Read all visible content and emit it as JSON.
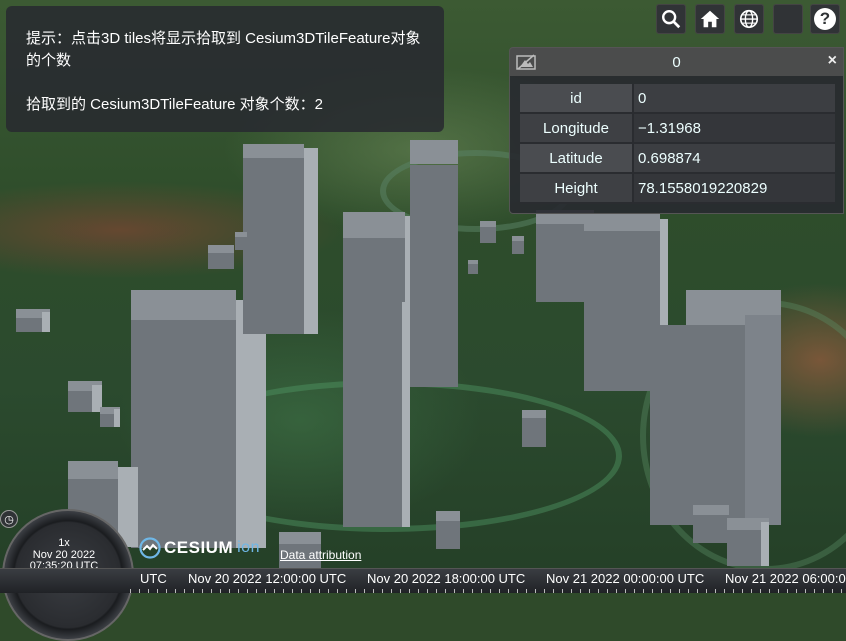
{
  "info_panel": {
    "hint": "提示：点击3D tiles将显示拾取到 Cesium3DTileFeature对象的个数",
    "count_line": "拾取到的 Cesium3DTileFeature 对象个数：2"
  },
  "toolbar": {
    "search_icon": "search-icon",
    "home_icon": "home-icon",
    "scene_mode_icon": "globe-icon",
    "base_layer_icon": "layers-icon",
    "help_label": "?"
  },
  "infobox": {
    "title": "0",
    "close_label": "×",
    "properties": [
      {
        "key": "id",
        "value": "0"
      },
      {
        "key": "Longitude",
        "value": "−1.31968"
      },
      {
        "key": "Latitude",
        "value": "0.698874"
      },
      {
        "key": "Height",
        "value": "78.1558019220829"
      }
    ]
  },
  "animation": {
    "speed": "1x",
    "date": "Nov 20 2022",
    "time": "07:35:20 UTC"
  },
  "timeline": {
    "ticks": [
      "UTC",
      "Nov 20 2022 12:00:00 UTC",
      "Nov 20 2022 18:00:00 UTC",
      "Nov 21 2022 00:00:00 UTC",
      "Nov 21 2022 06:00:00"
    ]
  },
  "credits": {
    "logo_text": "CESIUM",
    "logo_suffix": "ion",
    "attribution": "Data attribution"
  },
  "colors": {
    "panel_bg": "#282a30",
    "building_top": "#8a9096",
    "building_front": "#6f757b",
    "building_side": "#a9afb4"
  }
}
